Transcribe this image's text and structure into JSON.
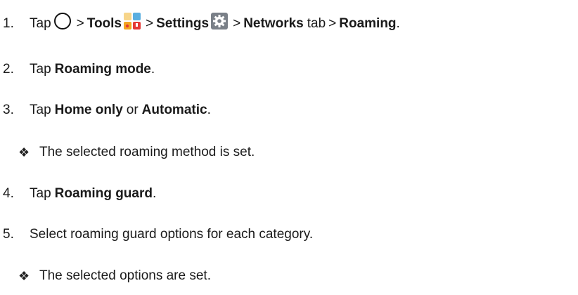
{
  "steps": [
    {
      "number": "1.",
      "parts": {
        "tap": "Tap",
        "gt1": ">",
        "tools": "Tools",
        "gt2": ">",
        "settings": "Settings",
        "gt3": ">",
        "networks": "Networks",
        "tab": "tab",
        "gt4": ">",
        "roaming": "Roaming",
        "period": "."
      },
      "icons": [
        "home-circle-icon",
        "tools-icon",
        "settings-gear-icon"
      ]
    },
    {
      "number": "2.",
      "tap": "Tap",
      "bold": "Roaming mode",
      "end": "."
    },
    {
      "number": "3.",
      "tap": "Tap",
      "bold1": "Home only",
      "or": "or",
      "bold2": "Automatic",
      "end": "."
    },
    {
      "bullet": "❖",
      "text": "The selected roaming method is set."
    },
    {
      "number": "4.",
      "tap": "Tap",
      "bold": "Roaming guard",
      "end": "."
    },
    {
      "number": "5.",
      "text": "Select roaming guard options for each category."
    },
    {
      "bullet": "❖",
      "text": "The selected options are set."
    }
  ],
  "colors": {
    "text": "#1a1a1a",
    "gear_bg": "#7a8088",
    "tools_orange": "#f3a521",
    "tools_blue": "#5aaee0",
    "tools_red": "#e53935"
  }
}
